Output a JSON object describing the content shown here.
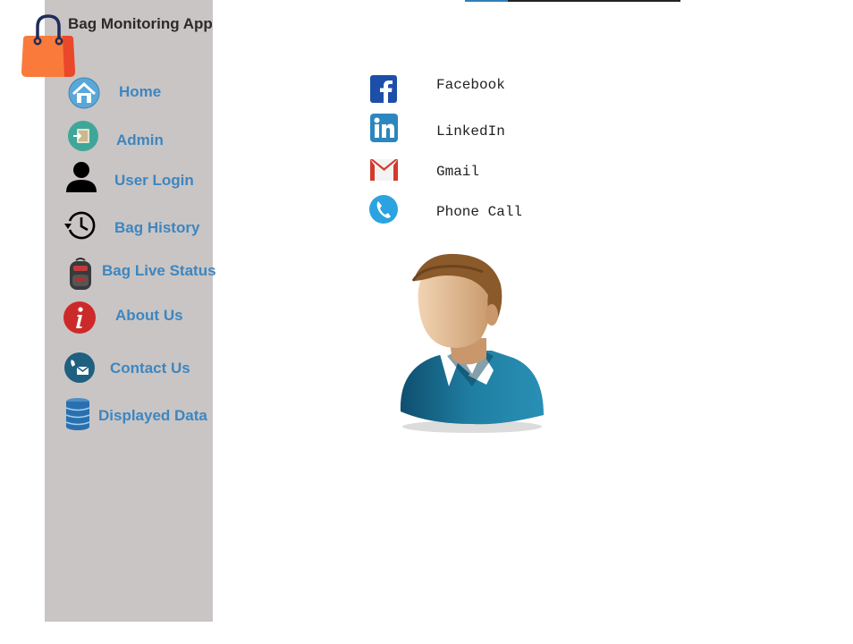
{
  "app": {
    "title": "Bag Monitoring App"
  },
  "sidebar": {
    "items": [
      {
        "label": "Home",
        "icon": "home-icon"
      },
      {
        "label": "Admin",
        "icon": "admin-icon"
      },
      {
        "label": "User Login",
        "icon": "user-icon"
      },
      {
        "label": "Bag History",
        "icon": "history-icon"
      },
      {
        "label": "Bag Live Status",
        "icon": "backpack-icon"
      },
      {
        "label": "About Us",
        "icon": "info-icon"
      },
      {
        "label": "Contact Us",
        "icon": "contact-icon"
      },
      {
        "label": "Displayed Data",
        "icon": "database-icon"
      }
    ]
  },
  "contacts": [
    {
      "label": "Facebook",
      "icon": "facebook-icon"
    },
    {
      "label": "LinkedIn",
      "icon": "linkedin-icon"
    },
    {
      "label": "Gmail",
      "icon": "gmail-icon"
    },
    {
      "label": "Phone Call",
      "icon": "phone-icon"
    }
  ],
  "colors": {
    "sidebar_bg": "#c9c5c4",
    "nav_text": "#3d86c0",
    "logo_orange": "#f97a3a"
  }
}
